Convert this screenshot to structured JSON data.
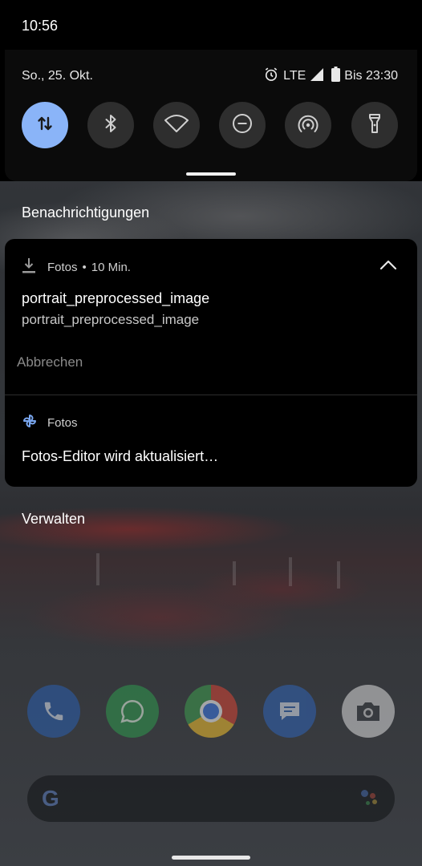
{
  "status_bar": {
    "time": "10:56",
    "date": "So., 25. Okt.",
    "network": "LTE",
    "battery_text": "Bis 23:30",
    "icons": [
      "alarm-icon",
      "signal-icon",
      "battery-icon"
    ]
  },
  "quick_settings": {
    "tiles": [
      {
        "name": "mobile-data",
        "icon": "mobile-data-icon",
        "active": true
      },
      {
        "name": "bluetooth",
        "icon": "bluetooth-icon",
        "active": false
      },
      {
        "name": "wifi",
        "icon": "wifi-icon",
        "active": false
      },
      {
        "name": "do-not-disturb",
        "icon": "do-not-disturb-icon",
        "active": false
      },
      {
        "name": "hotspot",
        "icon": "hotspot-icon",
        "active": false
      },
      {
        "name": "flashlight",
        "icon": "flashlight-icon",
        "active": false
      }
    ],
    "active_color": "#8ab4f8",
    "inactive_color": "#2e2e2e"
  },
  "notifications": {
    "header": "Benachrichtigungen",
    "items": [
      {
        "app": "Fotos",
        "separator": "•",
        "time": "10 Min.",
        "icon": "download-icon",
        "title": "portrait_preprocessed_image",
        "text": "portrait_preprocessed_image",
        "action": "Abbrechen"
      },
      {
        "app": "Fotos",
        "icon": "pinwheel-icon",
        "title": "Fotos-Editor wird aktualisiert…"
      }
    ],
    "manage_label": "Verwalten"
  },
  "dock": {
    "apps": [
      "phone-icon",
      "whatsapp-icon",
      "chrome-icon",
      "messages-icon",
      "camera-icon"
    ]
  }
}
